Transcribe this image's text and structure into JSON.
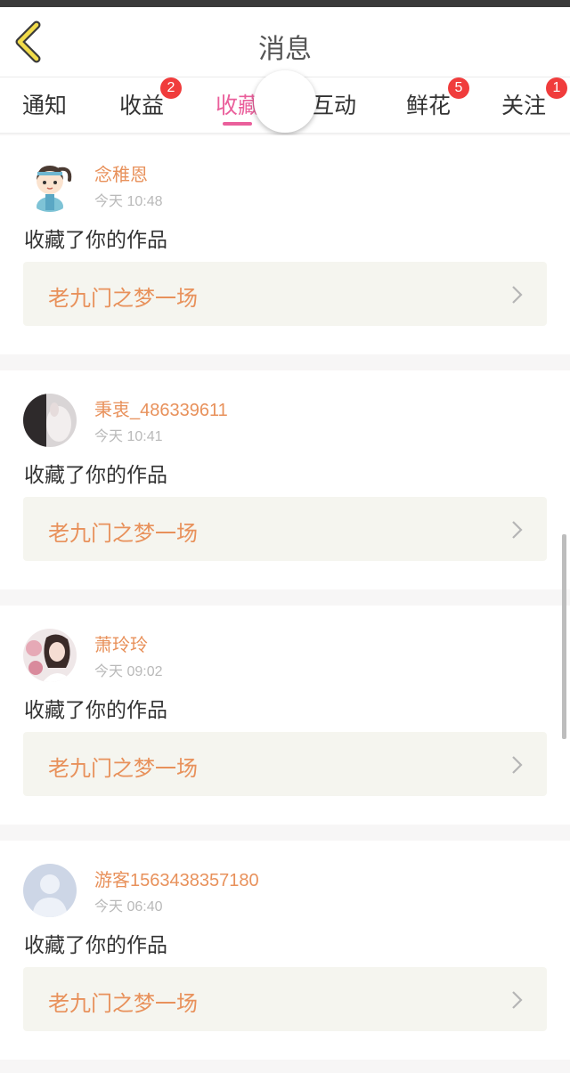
{
  "header": {
    "title": "消息",
    "back_icon": "chevron-left-icon"
  },
  "tabs": [
    {
      "label": "通知",
      "badge": ""
    },
    {
      "label": "收益",
      "badge": "2"
    },
    {
      "label": "收藏",
      "badge": "",
      "active": true
    },
    {
      "label": "互动",
      "badge": ""
    },
    {
      "label": "鲜花",
      "badge": "5"
    },
    {
      "label": "关注",
      "badge": "1"
    }
  ],
  "colors": {
    "accent": "#ea5f9b",
    "name": "#e8915b",
    "badge": "#f03c3c",
    "work_bg": "#f5f5ef"
  },
  "messages": [
    {
      "user": "念稚恩",
      "time": "今天 10:48",
      "action": "收藏了你的作品",
      "work": "老九门之梦一场"
    },
    {
      "user": "秉衷_486339611",
      "time": "今天 10:41",
      "action": "收藏了你的作品",
      "work": "老九门之梦一场"
    },
    {
      "user": "萧玲玲",
      "time": "今天 09:02",
      "action": "收藏了你的作品",
      "work": "老九门之梦一场"
    },
    {
      "user": "游客1563438357180",
      "time": "今天 06:40",
      "action": "收藏了你的作品",
      "work": "老九门之梦一场"
    }
  ]
}
